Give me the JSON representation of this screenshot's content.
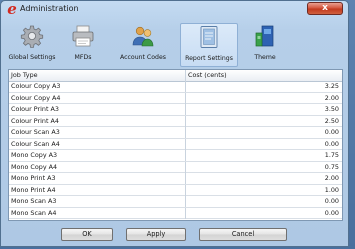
{
  "window": {
    "title": "Administration",
    "app_icon_glyph": "e",
    "close_glyph": "x",
    "accent_color": "#d22a21"
  },
  "toolbar": {
    "items": [
      {
        "label": "Global Settings",
        "icon": "gear-icon",
        "active": false
      },
      {
        "label": "MFDs",
        "icon": "printer-icon",
        "active": false
      },
      {
        "label": "Account Codes",
        "icon": "users-icon",
        "active": false
      },
      {
        "label": "Report Settings",
        "icon": "document-icon",
        "active": true
      },
      {
        "label": "Theme",
        "icon": "theme-icon",
        "active": false
      }
    ]
  },
  "grid": {
    "columns": [
      "Job Type",
      "Cost (cents)"
    ],
    "rows": [
      {
        "job": "Colour Copy A3",
        "cost": "3.25"
      },
      {
        "job": "Colour Copy A4",
        "cost": "2.00"
      },
      {
        "job": "Colour Print A3",
        "cost": "3.50"
      },
      {
        "job": "Colour Print A4",
        "cost": "2.50"
      },
      {
        "job": "Colour Scan A3",
        "cost": "0.00"
      },
      {
        "job": "Colour Scan A4",
        "cost": "0.00"
      },
      {
        "job": "Mono Copy A3",
        "cost": "1.75"
      },
      {
        "job": "Mono Copy A4",
        "cost": "0.75"
      },
      {
        "job": "Mono Print A3",
        "cost": "2.00"
      },
      {
        "job": "Mono Print A4",
        "cost": "1.00"
      },
      {
        "job": "Mono Scan A3",
        "cost": "0.00"
      },
      {
        "job": "Mono Scan A4",
        "cost": "0.00"
      }
    ]
  },
  "buttons": {
    "ok": "OK",
    "apply": "Apply",
    "cancel": "Cancel"
  }
}
